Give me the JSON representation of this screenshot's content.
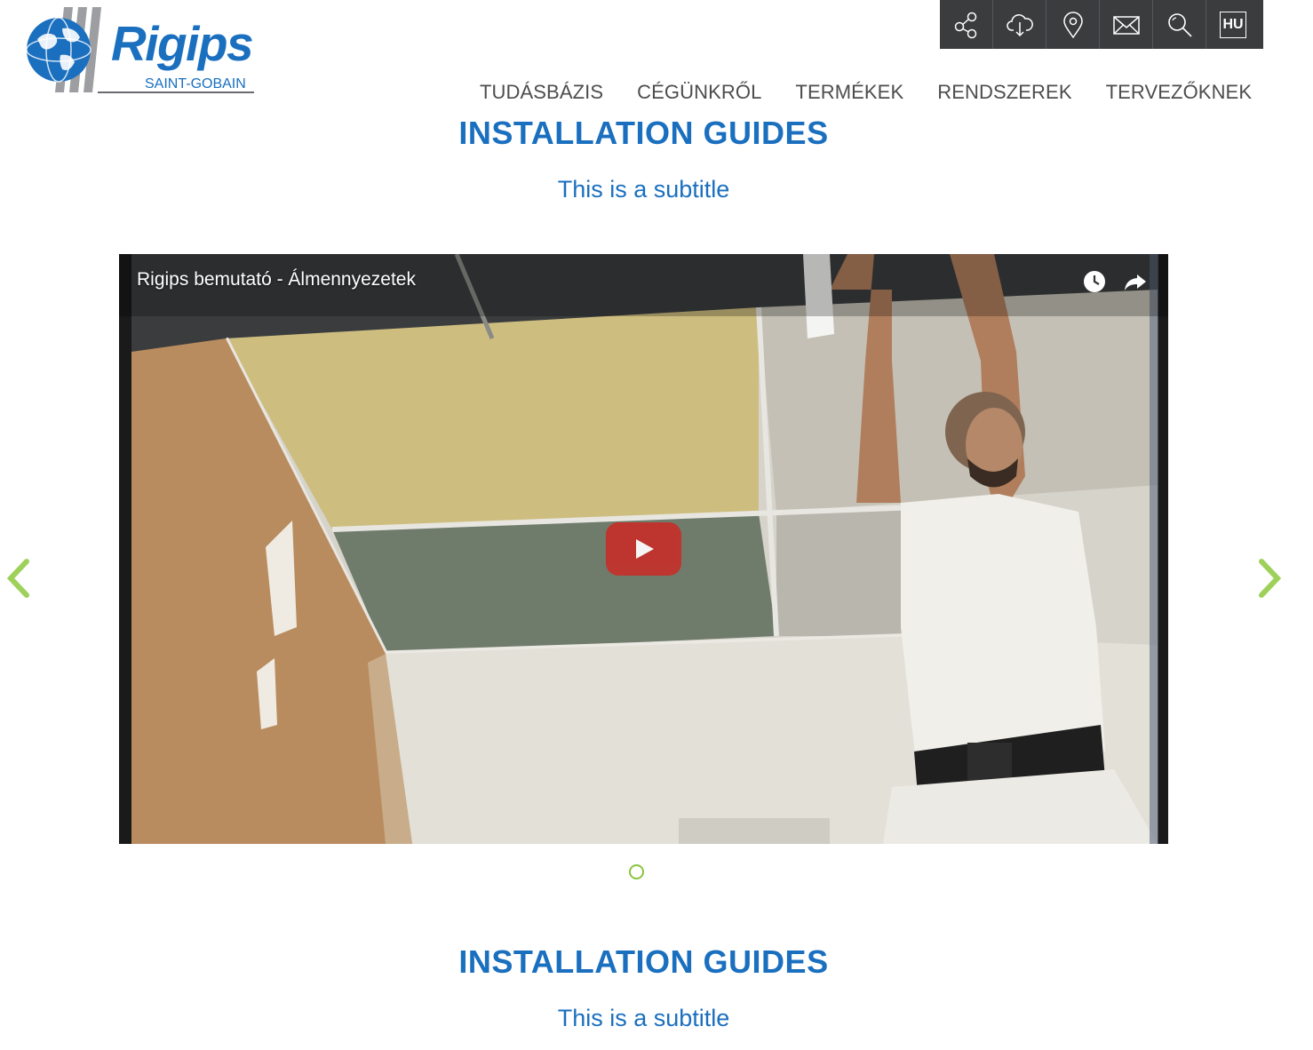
{
  "brand": {
    "name": "Rigips",
    "parent": "SAINT-GOBAIN",
    "color": "#1a6fbf"
  },
  "toolbar": {
    "icons": [
      "share-icon",
      "cloud-download-icon",
      "map-pin-icon",
      "mail-icon",
      "search-icon"
    ],
    "language": "HU"
  },
  "nav": {
    "items": [
      "TUDÁSBÁZIS",
      "CÉGÜNKRŐL",
      "TERMÉKEK",
      "RENDSZEREK",
      "TERVEZŐKNEK"
    ]
  },
  "section1": {
    "title": "INSTALLATION GUIDES",
    "subtitle": "This is a subtitle"
  },
  "video": {
    "title": "Rigips bemutató - Álmennyezetek",
    "icons": [
      "watch-later-icon",
      "share-arrow-icon",
      "play-icon"
    ]
  },
  "carousel": {
    "accent": "#8cc43f",
    "slides": 1,
    "active": 0
  },
  "section2": {
    "title": "INSTALLATION GUIDES",
    "subtitle": "This is a subtitle"
  }
}
